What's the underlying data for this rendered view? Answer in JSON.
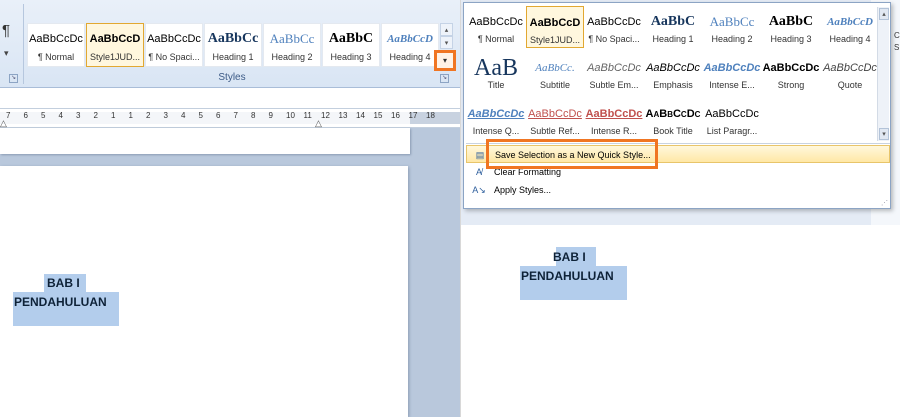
{
  "ribbon": {
    "paragraph_mark": "¶",
    "styles_group_label": "Styles",
    "gallery": [
      {
        "sample": "AaBbCcDc",
        "label": "¶ Normal"
      },
      {
        "sample": "AaBbCcD",
        "label": "Style1JUD..."
      },
      {
        "sample": "AaBbCcDc",
        "label": "¶ No Spaci..."
      },
      {
        "sample": "AaBbCc",
        "label": "Heading 1"
      },
      {
        "sample": "AaBbCc",
        "label": "Heading 2"
      },
      {
        "sample": "AaBbC",
        "label": "Heading 3"
      },
      {
        "sample": "AaBbCcD",
        "label": "Heading 4"
      }
    ],
    "more_arrow": "▾",
    "scroll_up": "▴",
    "scroll_down": "▾"
  },
  "ruler": {
    "numbers": [
      "7",
      "6",
      "5",
      "4",
      "3",
      "2",
      "1",
      "1",
      "2",
      "3",
      "4",
      "5",
      "6",
      "7",
      "8",
      "9",
      "10",
      "11",
      "12",
      "13",
      "14",
      "15",
      "16",
      "17",
      "18"
    ]
  },
  "document_left": {
    "line1": "BAB I",
    "line2": "PENDAHULUAN"
  },
  "dropdown": {
    "styles": [
      {
        "sample": "AaBbCcDc",
        "label": "¶ Normal"
      },
      {
        "sample": "AaBbCcD",
        "label": "Style1JUD..."
      },
      {
        "sample": "AaBbCcDc",
        "label": "¶ No Spaci..."
      },
      {
        "sample": "AaBbC",
        "label": "Heading 1"
      },
      {
        "sample": "AaBbCc",
        "label": "Heading 2"
      },
      {
        "sample": "AaBbC",
        "label": "Heading 3"
      },
      {
        "sample": "AaBbCcD",
        "label": "Heading 4"
      },
      {
        "sample": "AaB",
        "label": "Title"
      },
      {
        "sample": "AaBbCc.",
        "label": "Subtitle"
      },
      {
        "sample": "AaBbCcDc",
        "label": "Subtle Em..."
      },
      {
        "sample": "AaBbCcDc",
        "label": "Emphasis"
      },
      {
        "sample": "AaBbCcDc",
        "label": "Intense E..."
      },
      {
        "sample": "AaBbCcDc",
        "label": "Strong"
      },
      {
        "sample": "AaBbCcDc",
        "label": "Quote"
      },
      {
        "sample": "AaBbCcDc",
        "label": "Intense Q..."
      },
      {
        "sample": "AaBbCcDc",
        "label": "Subtle Ref..."
      },
      {
        "sample": "AaBbCcDc",
        "label": "Intense R..."
      },
      {
        "sample": "AaBbCcDc",
        "label": "Book Title"
      },
      {
        "sample": "AaBbCcDc",
        "label": "List Paragr..."
      }
    ],
    "menu": {
      "save_selection": "Save Selection as a New Quick Style...",
      "clear_formatting": "Clear Formatting",
      "apply_styles": "Apply Styles..."
    }
  },
  "document_right": {
    "line1": "BAB I",
    "line2": "PENDAHULUAN"
  },
  "right_edge_cutoff": "C\nS",
  "colors": {
    "highlight": "#b3cdec",
    "callout_orange": "#f07522",
    "hover_yellow": "#ffe8a6"
  }
}
